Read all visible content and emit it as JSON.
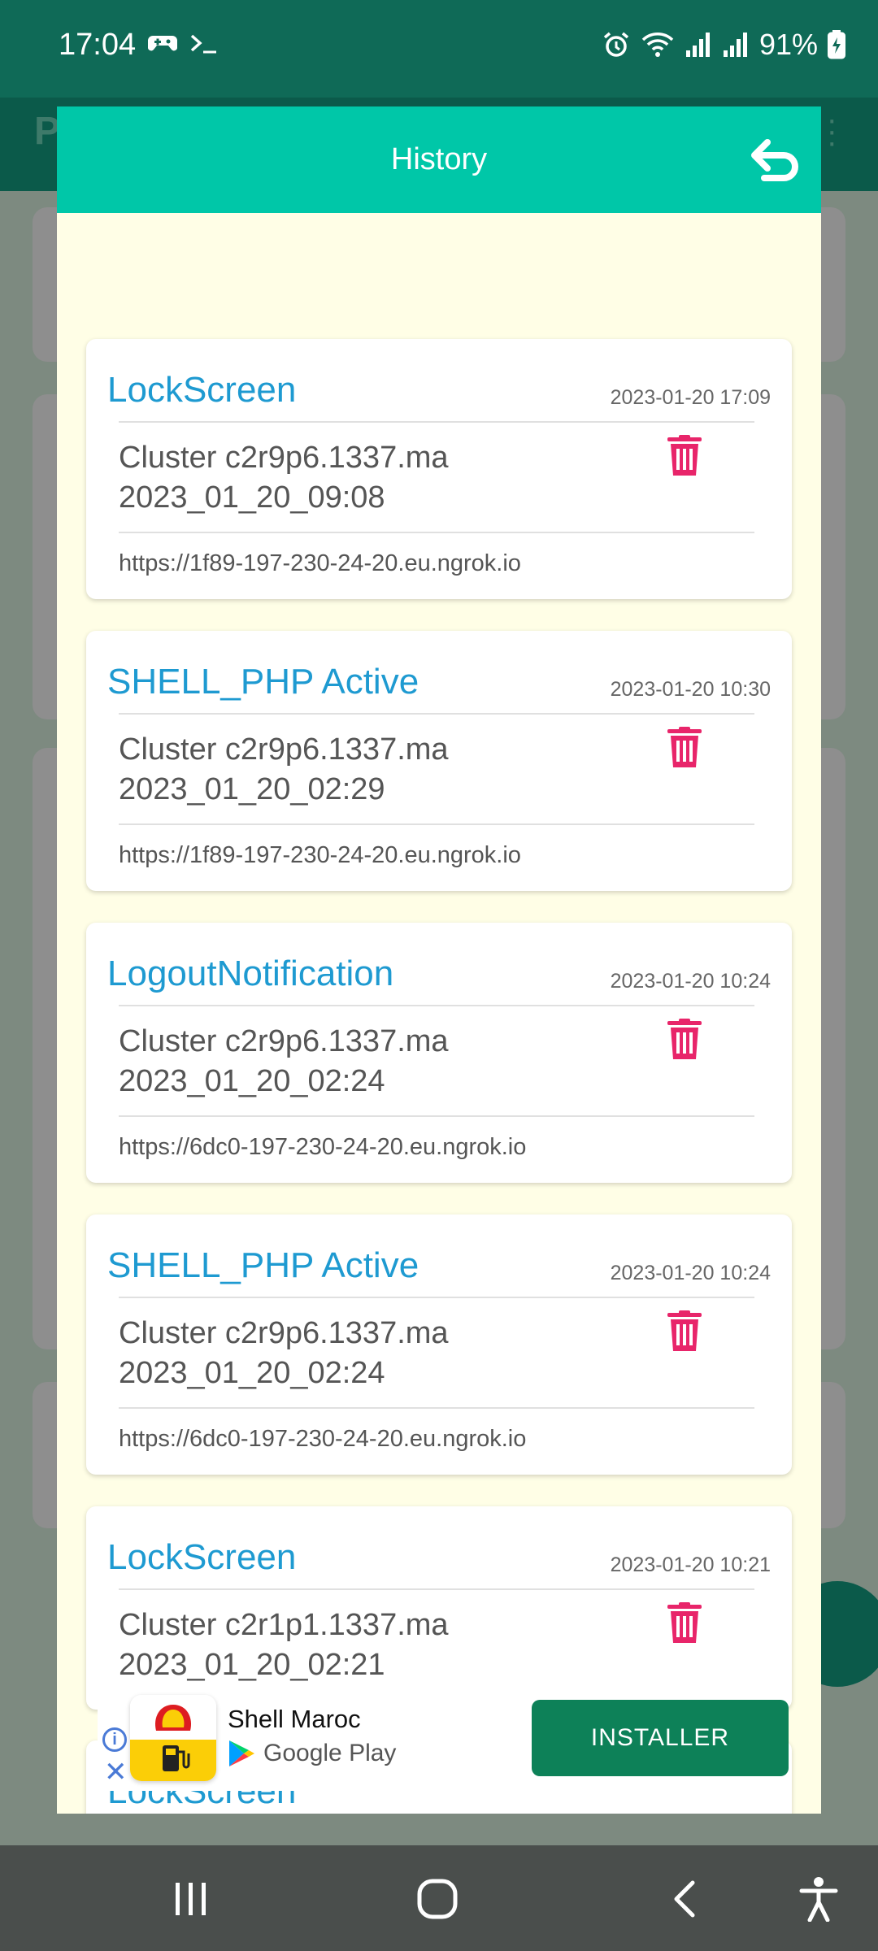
{
  "status_bar": {
    "time": "17:04",
    "battery": "91%"
  },
  "dialog": {
    "title": "History"
  },
  "history": [
    {
      "title": "LockScreen",
      "date": "2023-01-20 17:09",
      "desc": "Cluster c2r9p6.1337.ma\n2023_01_20_09:08",
      "url": "https://1f89-197-230-24-20.eu.ngrok.io"
    },
    {
      "title": "SHELL_PHP Active",
      "date": "2023-01-20 10:30",
      "desc": "Cluster c2r9p6.1337.ma\n2023_01_20_02:29",
      "url": "https://1f89-197-230-24-20.eu.ngrok.io"
    },
    {
      "title": "LogoutNotification",
      "date": "2023-01-20 10:24",
      "desc": "Cluster c2r9p6.1337.ma\n2023_01_20_02:24",
      "url": "https://6dc0-197-230-24-20.eu.ngrok.io"
    },
    {
      "title": "SHELL_PHP Active",
      "date": "2023-01-20 10:24",
      "desc": "Cluster c2r9p6.1337.ma\n2023_01_20_02:24",
      "url": "https://6dc0-197-230-24-20.eu.ngrok.io"
    },
    {
      "title": "LockScreen",
      "date": "2023-01-20 10:21",
      "desc": "Cluster c2r1p1.1337.ma\n2023_01_20_02:21",
      "url": ""
    },
    {
      "title": "LockScreen",
      "date": "",
      "desc": "",
      "url": ""
    }
  ],
  "ad": {
    "advertiser": "Shell Maroc",
    "store": "Google Play",
    "cta": "INSTALLER"
  },
  "colors": {
    "header": "#00c7a8",
    "card_title": "#1e9ad1",
    "trash": "#e8256a",
    "install_button": "#0d8158"
  }
}
